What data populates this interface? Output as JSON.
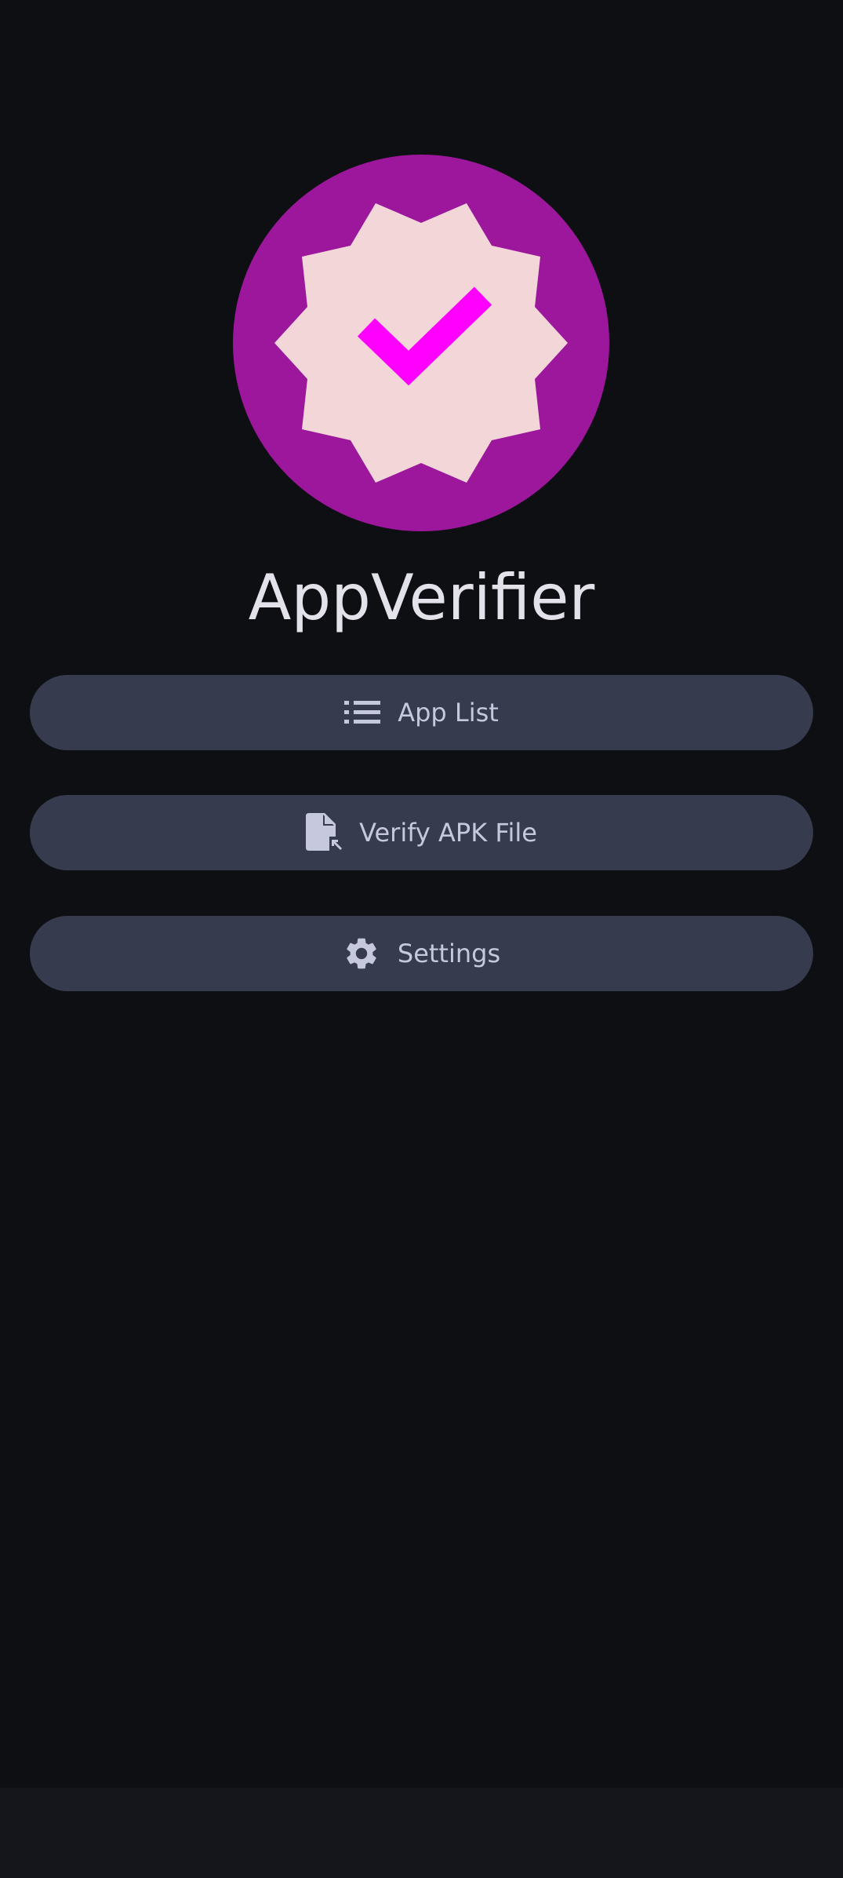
{
  "app": {
    "title": "AppVerifier",
    "logo_icon": "verified-badge-icon",
    "colors": {
      "background": "#0e0f13",
      "logo_circle": "#9c179c",
      "badge_fill": "#f3d6d8",
      "check_mark": "#ff00ff",
      "button_bg": "#363b4e",
      "button_text": "#c6c9de",
      "title_text": "#e3e2ea"
    }
  },
  "menu": {
    "items": [
      {
        "label": "App List",
        "icon": "list-icon"
      },
      {
        "label": "Verify APK File",
        "icon": "file-open-icon"
      },
      {
        "label": "Settings",
        "icon": "gear-icon"
      }
    ]
  }
}
